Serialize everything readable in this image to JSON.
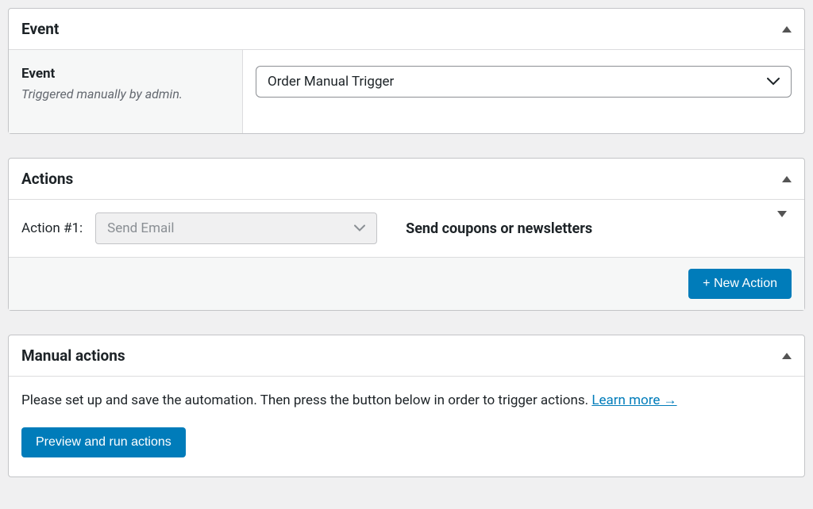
{
  "event": {
    "header": "Event",
    "label": "Event",
    "description": "Triggered manually by admin.",
    "selected": "Order Manual Trigger"
  },
  "actions": {
    "header": "Actions",
    "row_label": "Action #1:",
    "select_value": "Send Email",
    "title": "Send coupons or newsletters",
    "new_button": "+ New Action"
  },
  "manual": {
    "header": "Manual actions",
    "instruction": "Please set up and save the automation. Then press the button below in order to trigger actions. ",
    "learn_more": "Learn more →",
    "run_button": "Preview and run actions"
  }
}
